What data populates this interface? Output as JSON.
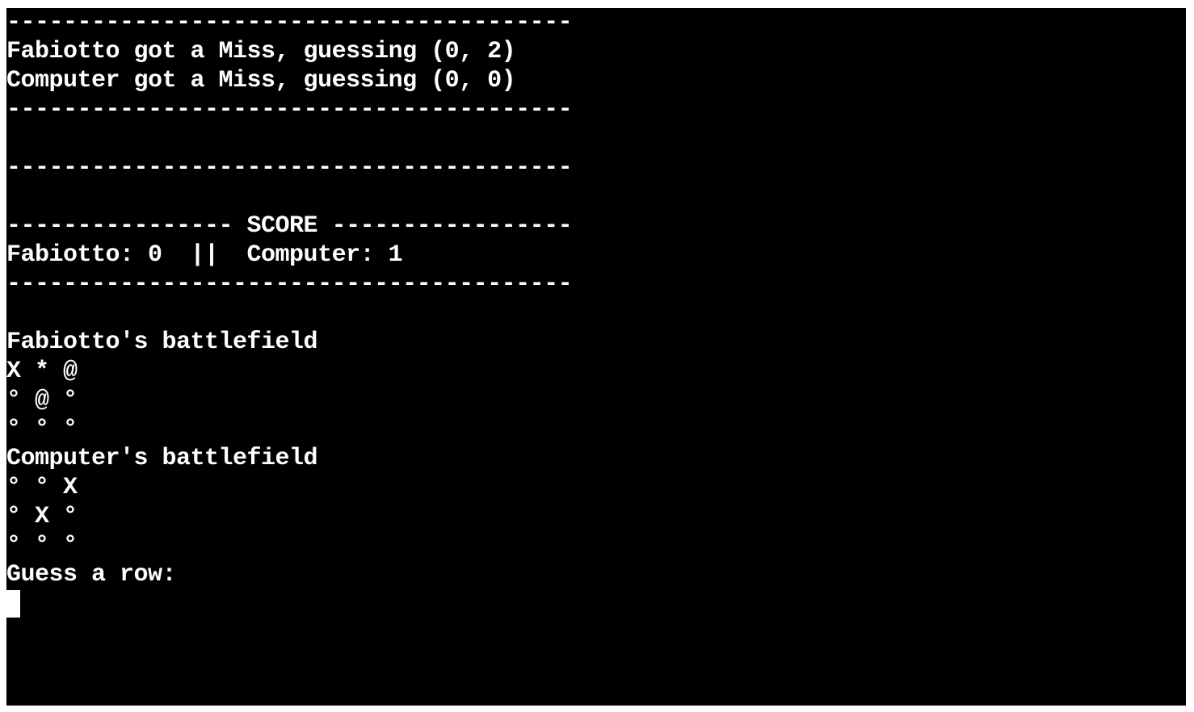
{
  "terminal": {
    "lines": [
      "----------------------------------------",
      "Fabiotto got a Miss, guessing (0, 2)",
      "Computer got a Miss, guessing (0, 0)",
      "----------------------------------------",
      "",
      "----------------------------------------",
      "",
      "---------------- SCORE -----------------",
      "Fabiotto: 0  ||  Computer: 1",
      "----------------------------------------",
      "",
      "Fabiotto's battlefield",
      "X * @",
      "° @ °",
      "° ° °",
      "Computer's battlefield",
      "° ° X",
      "° X °",
      "° ° °",
      "Guess a row:"
    ],
    "cursor": "block"
  }
}
